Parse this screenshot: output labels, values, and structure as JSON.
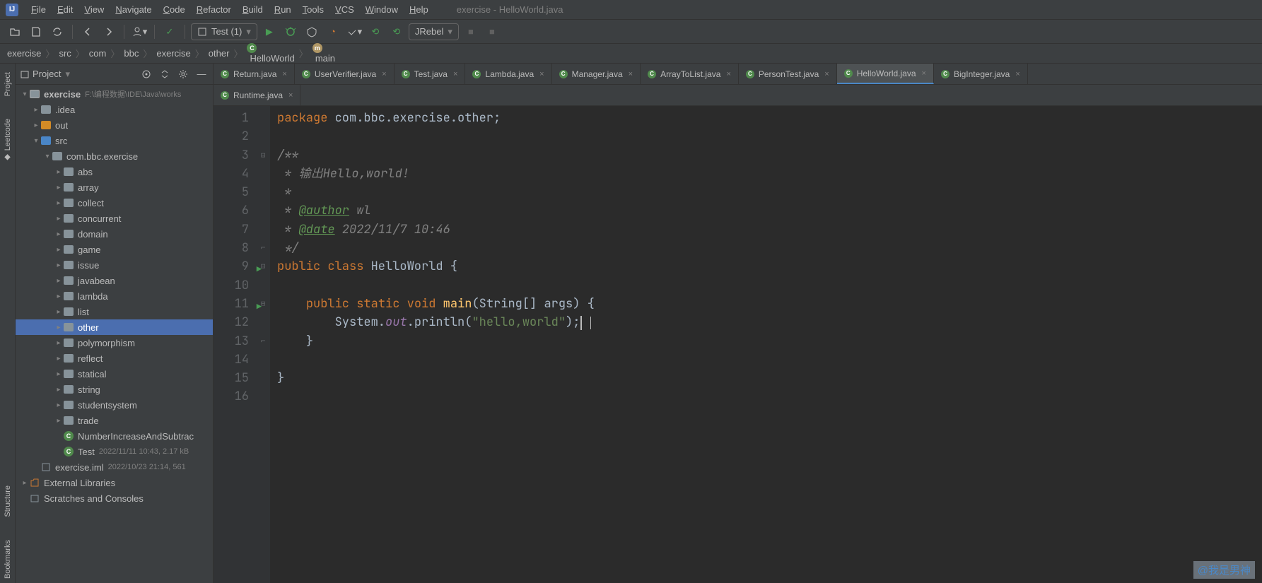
{
  "window_title": "exercise - HelloWorld.java",
  "menu": [
    "File",
    "Edit",
    "View",
    "Navigate",
    "Code",
    "Refactor",
    "Build",
    "Run",
    "Tools",
    "VCS",
    "Window",
    "Help"
  ],
  "run_config": "Test (1)",
  "jrebel_label": "JRebel",
  "breadcrumb": [
    {
      "label": "exercise"
    },
    {
      "label": "src"
    },
    {
      "label": "com"
    },
    {
      "label": "bbc"
    },
    {
      "label": "exercise"
    },
    {
      "label": "other"
    },
    {
      "label": "HelloWorld",
      "icon": "class"
    },
    {
      "label": "main",
      "icon": "method"
    }
  ],
  "side_tabs": {
    "project": "Project",
    "leetcode": "Leetcode",
    "structure": "Structure",
    "bookmarks": "Bookmarks"
  },
  "project_panel": {
    "title": "Project"
  },
  "tree": {
    "root": {
      "label": "exercise",
      "meta": "F:\\编程数据\\IDE\\Java\\works"
    },
    "idea": ".idea",
    "out": "out",
    "src": "src",
    "pkg": "com.bbc.exercise",
    "folders": [
      "abs",
      "array",
      "collect",
      "concurrent",
      "domain",
      "game",
      "issue",
      "javabean",
      "lambda",
      "list",
      "other",
      "polymorphism",
      "reflect",
      "statical",
      "string",
      "studentsystem",
      "trade"
    ],
    "number_increase": "NumberIncreaseAndSubtrac",
    "test": {
      "label": "Test",
      "meta": "2022/11/11 10:43, 2.17 kB"
    },
    "iml": {
      "label": "exercise.iml",
      "meta": "2022/10/23 21:14, 561"
    },
    "ext_lib": "External Libraries",
    "scratches": "Scratches and Consoles"
  },
  "tabs_row1": [
    "Return.java",
    "UserVerifier.java",
    "Test.java",
    "Lambda.java",
    "Manager.java",
    "ArrayToList.java",
    "PersonTest.java",
    "HelloWorld.java",
    "BigInteger.java"
  ],
  "tabs_row2": [
    "Runtime.java"
  ],
  "active_tab": "HelloWorld.java",
  "code": {
    "package_kw": "package",
    "package_val": " com.bbc.exercise.other;",
    "cmt_open": "/**",
    "cmt_l1": " * 输出Hello,world!",
    "cmt_l2": " *",
    "cmt_author_tag": "@author",
    "cmt_author_val": " wl",
    "cmt_date_tag": "@date",
    "cmt_date_val": " 2022/11/7 10:46",
    "cmt_close": " */",
    "public_kw": "public",
    "class_kw": "class",
    "classname": "HelloWorld",
    "static_kw": "static",
    "void_kw": "void",
    "main_mth": "main",
    "sig": "(String[] args) {",
    "sys": "System.",
    "out": "out",
    "println": ".println(",
    "str": "\"hello,world\"",
    "tail": ");",
    "brace_close": "}"
  },
  "line_count": 16,
  "watermark": "@我是男神"
}
